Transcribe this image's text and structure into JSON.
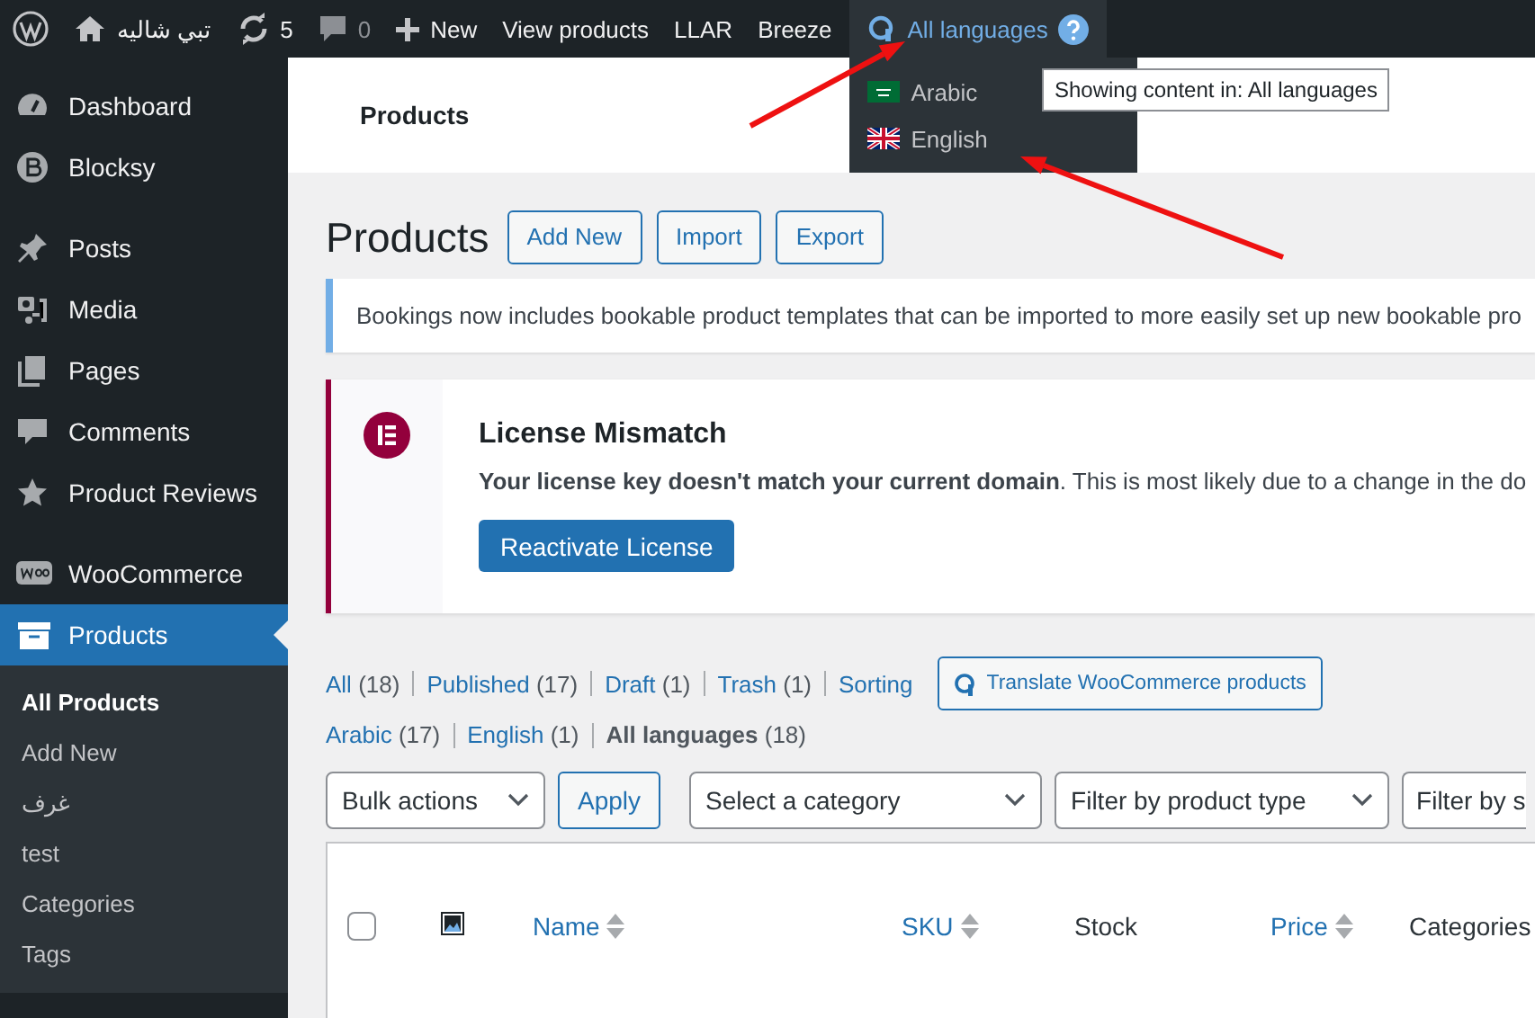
{
  "admin_bar": {
    "site_name": "تبي شاليه",
    "updates_count": "5",
    "comments_count": "0",
    "new_label": "New",
    "links": [
      "View products",
      "LLAR",
      "Breeze"
    ],
    "language_switcher": {
      "label": "All languages",
      "expanded": true,
      "options": [
        {
          "label": "Arabic",
          "kind": "sa"
        },
        {
          "label": "English",
          "kind": "uk"
        }
      ]
    },
    "tooltip": "Showing content in: All languages"
  },
  "sidebar": {
    "items": [
      {
        "label": "Dashboard",
        "selected": false
      },
      {
        "label": "Blocksy",
        "selected": false
      },
      {
        "label": "Posts",
        "selected": false,
        "gap": true
      },
      {
        "label": "Media",
        "selected": false
      },
      {
        "label": "Pages",
        "selected": false
      },
      {
        "label": "Comments",
        "selected": false
      },
      {
        "label": "Product Reviews",
        "selected": false
      },
      {
        "label": "WooCommerce",
        "selected": false,
        "gap": true
      },
      {
        "label": "Products",
        "selected": true,
        "children": [
          {
            "label": "All Products",
            "selected": true
          },
          {
            "label": "Add New",
            "selected": false
          },
          {
            "label": "غرف",
            "selected": false
          },
          {
            "label": "test",
            "selected": false
          },
          {
            "label": "Categories",
            "selected": false
          },
          {
            "label": "Tags",
            "selected": false
          }
        ]
      }
    ]
  },
  "screen_tab": "Products",
  "page": {
    "title": "Products",
    "actions": [
      "Add New",
      "Import",
      "Export"
    ]
  },
  "notice": "Bookings now includes bookable product templates that can be imported to more easily set up new bookable pro",
  "license_notice": {
    "title": "License Mismatch",
    "message": "**Your license key doesn't match your current domain**. This is most likely due to a change in the do",
    "button": "Reactivate License"
  },
  "status_filters": [
    {
      "label": "All",
      "count": "(18)"
    },
    {
      "label": "Published",
      "count": "(17)"
    },
    {
      "label": "Draft",
      "count": "(1)"
    },
    {
      "label": "Trash",
      "count": "(1)"
    },
    {
      "label": "Sorting"
    }
  ],
  "translate_button": "Translate WooCommerce products",
  "language_filters": [
    {
      "label": "Arabic",
      "count": "(17)",
      "selected": false
    },
    {
      "label": "English",
      "count": "(1)",
      "selected": false
    },
    {
      "label": "All languages",
      "count": "(18)",
      "selected": true
    }
  ],
  "bulk_actions": "Bulk actions",
  "apply": "Apply",
  "filters": [
    "Select a category",
    "Filter by product type",
    "Filter by s"
  ],
  "table": {
    "columns": [
      {
        "kind": "checkbox",
        "checked": false
      },
      {
        "kind": "image"
      },
      {
        "kind": "sortable",
        "label": "Name"
      },
      {
        "kind": "sortable",
        "label": "SKU"
      },
      {
        "kind": "plain",
        "label": "Stock"
      },
      {
        "kind": "sortable",
        "label": "Price"
      },
      {
        "kind": "plain",
        "label": "Categories"
      }
    ]
  },
  "annotations": [
    {
      "kind": "arrow"
    },
    {
      "kind": "arrow"
    }
  ]
}
